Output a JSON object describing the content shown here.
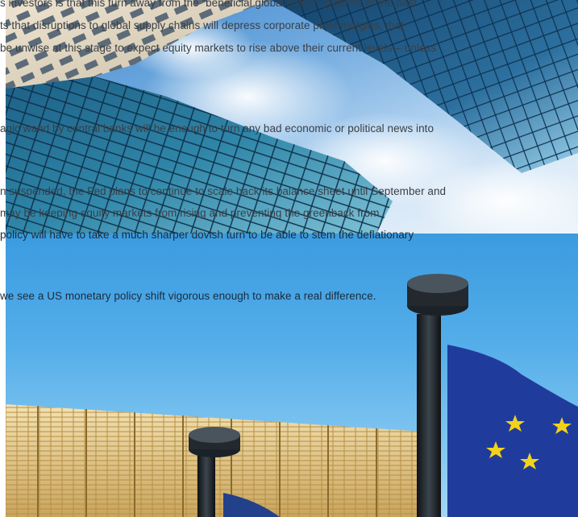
{
  "text_lines": [
    "s investors is that this turn away from the “beneficial globalisation” patterns of the past",
    "ts that disruptions to global supply chains will depress corporate profit margins, that",
    " be unwise at this stage to expect equity markets to rise above their current levels – unless",
    "agic wand by central banks will be enough to turn any bad economic or political news into",
    "n suspended, the Fed plans to continue to scale back its balance sheet until September and",
    "may be keeping equity markets from rising and preventing the greenback from",
    " policy will have to take a much sharper dovish turn to be able to stem the deflationary",
    "we see a US monetary policy shift vigorous enough to make a real difference."
  ],
  "images": {
    "top": "skyscrapers-photo",
    "bottom": "eu-flags-building-photo"
  },
  "colors": {
    "text": "#3a3f46",
    "sky_top": "#3f86cf",
    "sky_bottom": "#55aee9",
    "flag_blue": "#1f3c9c",
    "flag_star": "#f4d21b"
  }
}
